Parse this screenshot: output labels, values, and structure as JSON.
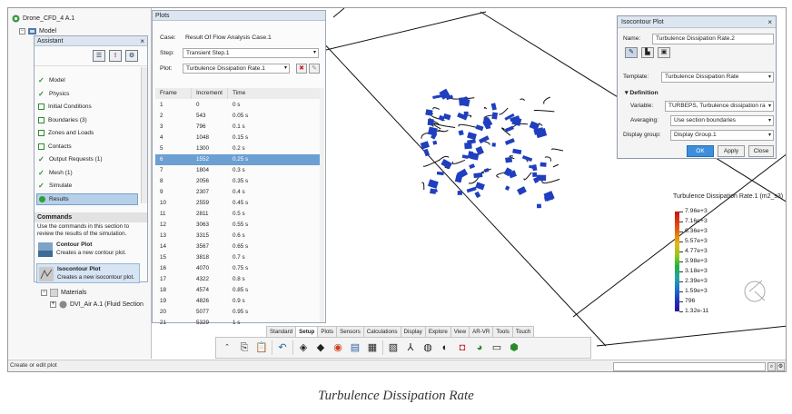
{
  "tree": {
    "root": "Drone_CFD_4 A.1",
    "model": "Model",
    "materials": "Materials",
    "material_item": "DVI_Air A.1 (Fluid Section"
  },
  "assistant": {
    "title": "Assistant",
    "close_glyph": "×",
    "steps": [
      {
        "label": "Model",
        "state": "done"
      },
      {
        "label": "Physics",
        "state": "done"
      },
      {
        "label": "Initial Conditions",
        "state": "todo"
      },
      {
        "label": "Boundaries (3)",
        "state": "todo"
      },
      {
        "label": "Zones and Loads",
        "state": "todo"
      },
      {
        "label": "Contacts",
        "state": "todo"
      },
      {
        "label": "Output Requests (1)",
        "state": "done"
      },
      {
        "label": "Mesh (1)",
        "state": "done"
      },
      {
        "label": "Simulate",
        "state": "done"
      },
      {
        "label": "Results",
        "state": "active"
      }
    ],
    "commands_heading": "Commands",
    "commands_desc": "Use the commands in this section to review the results of the simulation.",
    "commands": [
      {
        "title": "Contour Plot",
        "desc": "Creates a new contour plot."
      },
      {
        "title": "Isocontour Plot",
        "desc": "Creates a new isocontour plot."
      }
    ]
  },
  "plots": {
    "title": "Plots",
    "case_label": "Case:",
    "case_value": "Result Of Flow Analysis Case.1",
    "step_label": "Step:",
    "step_value": "Transient Step.1",
    "plot_label": "Plot:",
    "plot_value": "Turbulence Dissipation Rate.1",
    "columns": [
      "Frame",
      "Increment",
      "Time"
    ],
    "selected_index": 6,
    "rows": [
      [
        "1",
        "0",
        "0 s"
      ],
      [
        "2",
        "543",
        "0.05 s"
      ],
      [
        "3",
        "796",
        "0.1 s"
      ],
      [
        "4",
        "1048",
        "0.15 s"
      ],
      [
        "5",
        "1300",
        "0.2 s"
      ],
      [
        "6",
        "1552",
        "0.25 s"
      ],
      [
        "7",
        "1804",
        "0.3 s"
      ],
      [
        "8",
        "2056",
        "0.35 s"
      ],
      [
        "9",
        "2307",
        "0.4 s"
      ],
      [
        "10",
        "2559",
        "0.45 s"
      ],
      [
        "11",
        "2811",
        "0.5 s"
      ],
      [
        "12",
        "3063",
        "0.55 s"
      ],
      [
        "13",
        "3315",
        "0.6 s"
      ],
      [
        "14",
        "3567",
        "0.65 s"
      ],
      [
        "15",
        "3818",
        "0.7 s"
      ],
      [
        "16",
        "4070",
        "0.75 s"
      ],
      [
        "17",
        "4322",
        "0.8 s"
      ],
      [
        "18",
        "4574",
        "0.85 s"
      ],
      [
        "19",
        "4826",
        "0.9 s"
      ],
      [
        "20",
        "5077",
        "0.95 s"
      ],
      [
        "21",
        "5329",
        "1 s"
      ]
    ]
  },
  "iso": {
    "title": "Isocontour Plot",
    "close_glyph": "×",
    "name_label": "Name:",
    "name_value": "Turbulence Dissipation Rate.2",
    "template_label": "Template:",
    "template_value": "Turbulence Dissipation Rate",
    "definition_heading": "Definition",
    "variable_label": "Variable:",
    "variable_value": "TURBEPS, Turbulence dissipation ra",
    "averaging_label": "Averaging:",
    "averaging_value": "Use section boundaries",
    "display_group_label": "Display group:",
    "display_group_value": "Display Group.1",
    "ok": "OK",
    "apply": "Apply",
    "close": "Close"
  },
  "legend": {
    "title": "Turbulence Dissipation Rate.1 (m2_s3)",
    "labels": [
      "7.96e+3",
      "7.16e+3",
      "6.36e+3",
      "5.57e+3",
      "4.77e+3",
      "3.98e+3",
      "3.18e+3",
      "2.39e+3",
      "1.59e+3",
      "796",
      "1.32e-11"
    ]
  },
  "ribbon": {
    "tabs": [
      "Standard",
      "Setup",
      "Plots",
      "Sensors",
      "Calculations",
      "Display",
      "Explore",
      "View",
      "AR-VR",
      "Tools",
      "Touch"
    ],
    "active_tab": "Setup"
  },
  "status": {
    "text": "Create or edit plot"
  },
  "caption": "Turbulence Dissipation Rate",
  "colors": {
    "accent": "#3d8fdc",
    "selection": "#6c9fd2",
    "particles": "#1f3fbf"
  }
}
